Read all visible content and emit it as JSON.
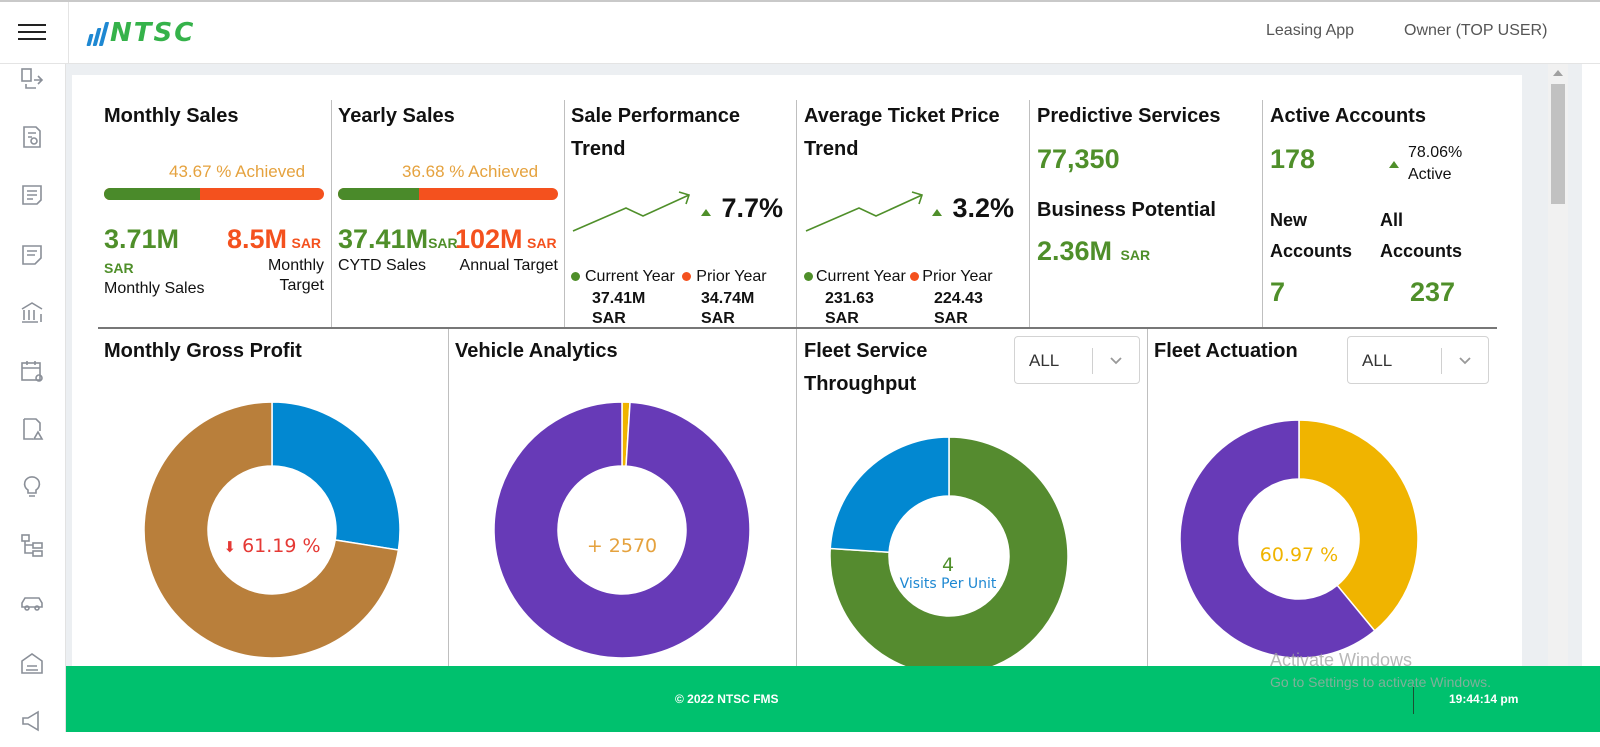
{
  "header": {
    "brand": "NTSC",
    "app_link": "Leasing App",
    "user_link": "Owner (TOP USER)"
  },
  "kpis": {
    "monthly_sales": {
      "title": "Monthly Sales",
      "achieved": "43.67 % Achieved",
      "achieved_fraction": 0.4367,
      "value": "3.71M",
      "value_unit": "SAR",
      "value_label": "Monthly Sales",
      "target": "8.5M",
      "target_unit": "SAR",
      "target_label_1": "Monthly",
      "target_label_2": "Target"
    },
    "yearly_sales": {
      "title": "Yearly Sales",
      "achieved": "36.68 % Achieved",
      "achieved_fraction": 0.3668,
      "value": "37.41M",
      "value_unit": "SAR",
      "value_label": "CYTD Sales",
      "target": "102M",
      "target_unit": "SAR",
      "target_label": "Annual Target"
    },
    "sale_performance": {
      "title_1": "Sale Performance",
      "title_2": "Trend",
      "pct": "7.7%",
      "current_label": "Current Year",
      "prior_label": "Prior Year",
      "current_value": "37.41M",
      "current_unit": "SAR",
      "prior_value": "34.74M",
      "prior_unit": "SAR"
    },
    "avg_ticket": {
      "title_1": "Average Ticket Price",
      "title_2": "Trend",
      "pct": "3.2%",
      "current_label": "Current Year",
      "prior_label": "Prior Year",
      "current_value": "231.63",
      "current_unit": "SAR",
      "prior_value": "224.43",
      "prior_unit": "SAR"
    },
    "predictive": {
      "title": "Predictive Services",
      "value": "77,350",
      "bp_title": "Business Potential",
      "bp_value": "2.36M",
      "bp_unit": "SAR"
    },
    "active_accounts": {
      "title": "Active Accounts",
      "value": "178",
      "pct": "78.06%",
      "pct_label": "Active",
      "new_label_1": "New",
      "new_label_2": "Accounts",
      "new_value": "7",
      "all_label_1": "All",
      "all_label_2": "Accounts",
      "all_value": "237"
    }
  },
  "charts": {
    "gross_profit": {
      "title": "Monthly Gross Profit",
      "center": "61.19 %",
      "center_arrow": "⬇"
    },
    "vehicle_analytics": {
      "title": "Vehicle Analytics",
      "center": "+ 2570"
    },
    "fleet_service": {
      "title_1": "Fleet Service",
      "title_2": "Throughput",
      "filter": "ALL",
      "center_value": "4",
      "center_label": "Visits Per Unit"
    },
    "fleet_actuation": {
      "title": "Fleet Actuation",
      "filter": "ALL",
      "center": "60.97 %"
    }
  },
  "chart_data": [
    {
      "type": "pie",
      "name_ref": "Monthly Gross Profit",
      "slices": [
        {
          "value": 27.5,
          "color": "#0288d1"
        },
        {
          "value": 72.5,
          "color": "#b97f3b"
        }
      ]
    },
    {
      "type": "pie",
      "name_ref": "Vehicle Analytics",
      "slices": [
        {
          "value": 1.0,
          "color": "#f0b400"
        },
        {
          "value": 99.0,
          "color": "#673ab7"
        }
      ]
    },
    {
      "type": "pie",
      "name_ref": "Fleet Service Throughput",
      "slices": [
        {
          "value": 64.6,
          "color": "#558b2f"
        },
        {
          "value": 0.0,
          "color": "#558b2f"
        },
        {
          "value": 20.4,
          "color": "#0288d1"
        }
      ]
    },
    {
      "type": "pie",
      "name_ref": "Fleet Actuation",
      "slices": [
        {
          "value": 39.03,
          "color": "#f0b400"
        },
        {
          "value": 60.97,
          "color": "#673ab7"
        }
      ]
    }
  ],
  "footer": {
    "copyright": "© 2022 NTSC FMS",
    "time": "19:44:14 pm"
  },
  "watermark": {
    "line1": "Activate Windows",
    "line2": "Go to Settings to activate Windows."
  },
  "colors": {
    "accent_green": "#4f8f2a",
    "accent_orange": "#f4511e",
    "footer_green": "#00c16e",
    "achieved_text": "#e5a23e"
  }
}
